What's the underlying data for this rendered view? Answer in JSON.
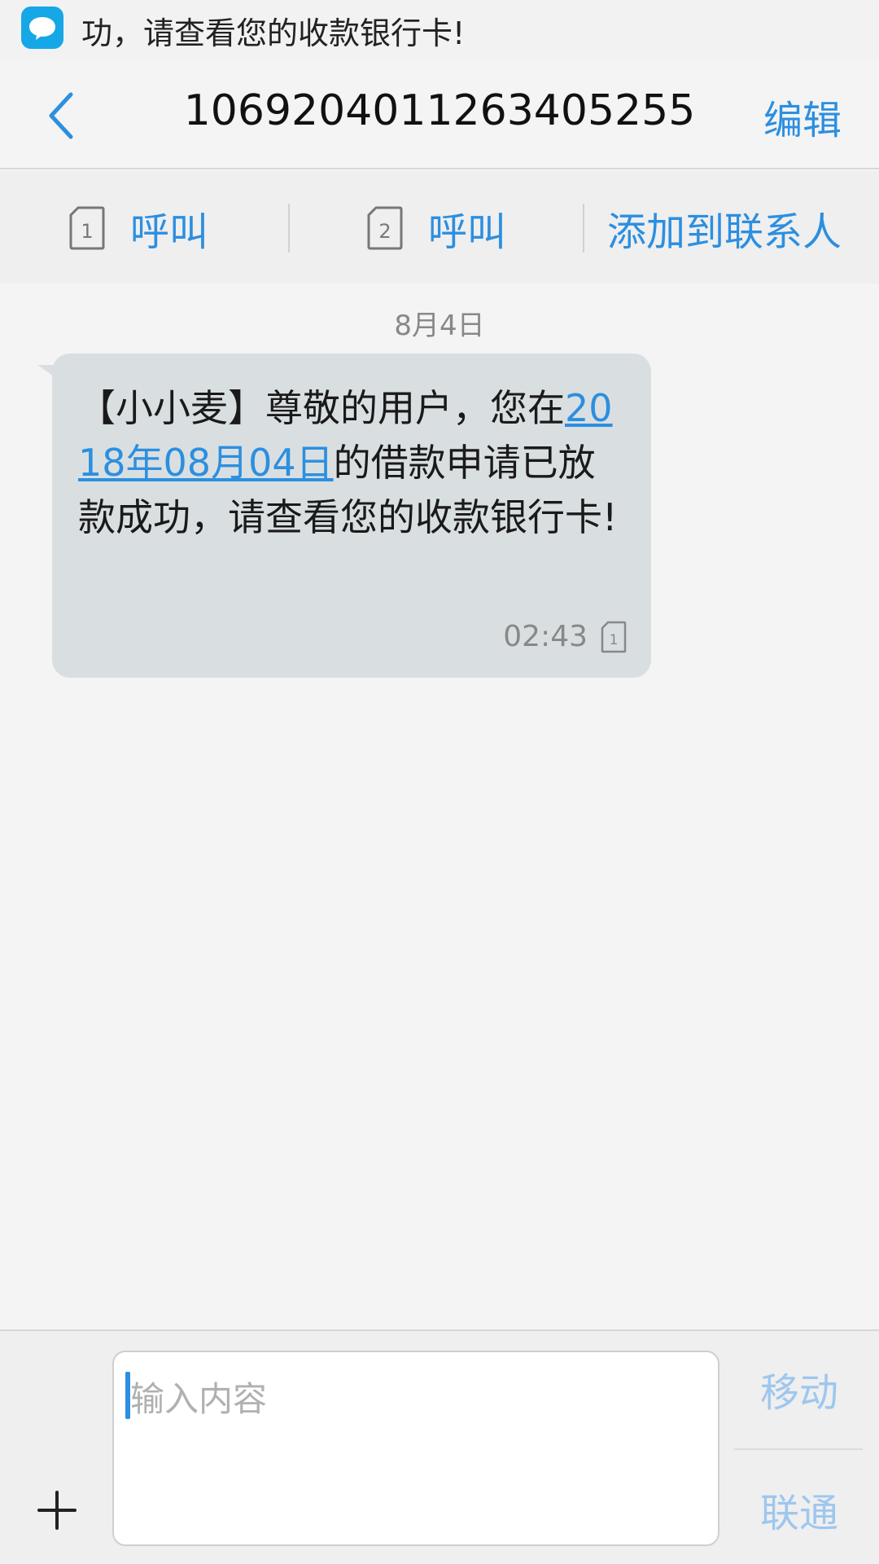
{
  "notification": {
    "icon": "message-bubble-icon",
    "text": "功，请查看您的收款银行卡!"
  },
  "header": {
    "back_icon": "chevron-left-icon",
    "title": "1069204011263405255",
    "edit_label": "编辑"
  },
  "actions": {
    "call1": {
      "sim": "1",
      "label": "呼叫"
    },
    "call2": {
      "sim": "2",
      "label": "呼叫"
    },
    "add_contact_label": "添加到联系人"
  },
  "conversation": {
    "date": "8月4日",
    "messages": [
      {
        "part1": "【小小麦】尊敬的用户，您在",
        "link": "2018年08月04日",
        "part2": "的借款申请已放款成功，请查看您的收款银行卡!",
        "time": "02:43",
        "sim": "1"
      }
    ]
  },
  "composer": {
    "placeholder": "输入内容",
    "plus_icon": "plus-icon",
    "carrier1": "移动",
    "carrier2": "联通"
  },
  "colors": {
    "accent": "#2c8fe0",
    "bubble": "#d9dfe1",
    "notif_icon": "#16a7e6"
  }
}
